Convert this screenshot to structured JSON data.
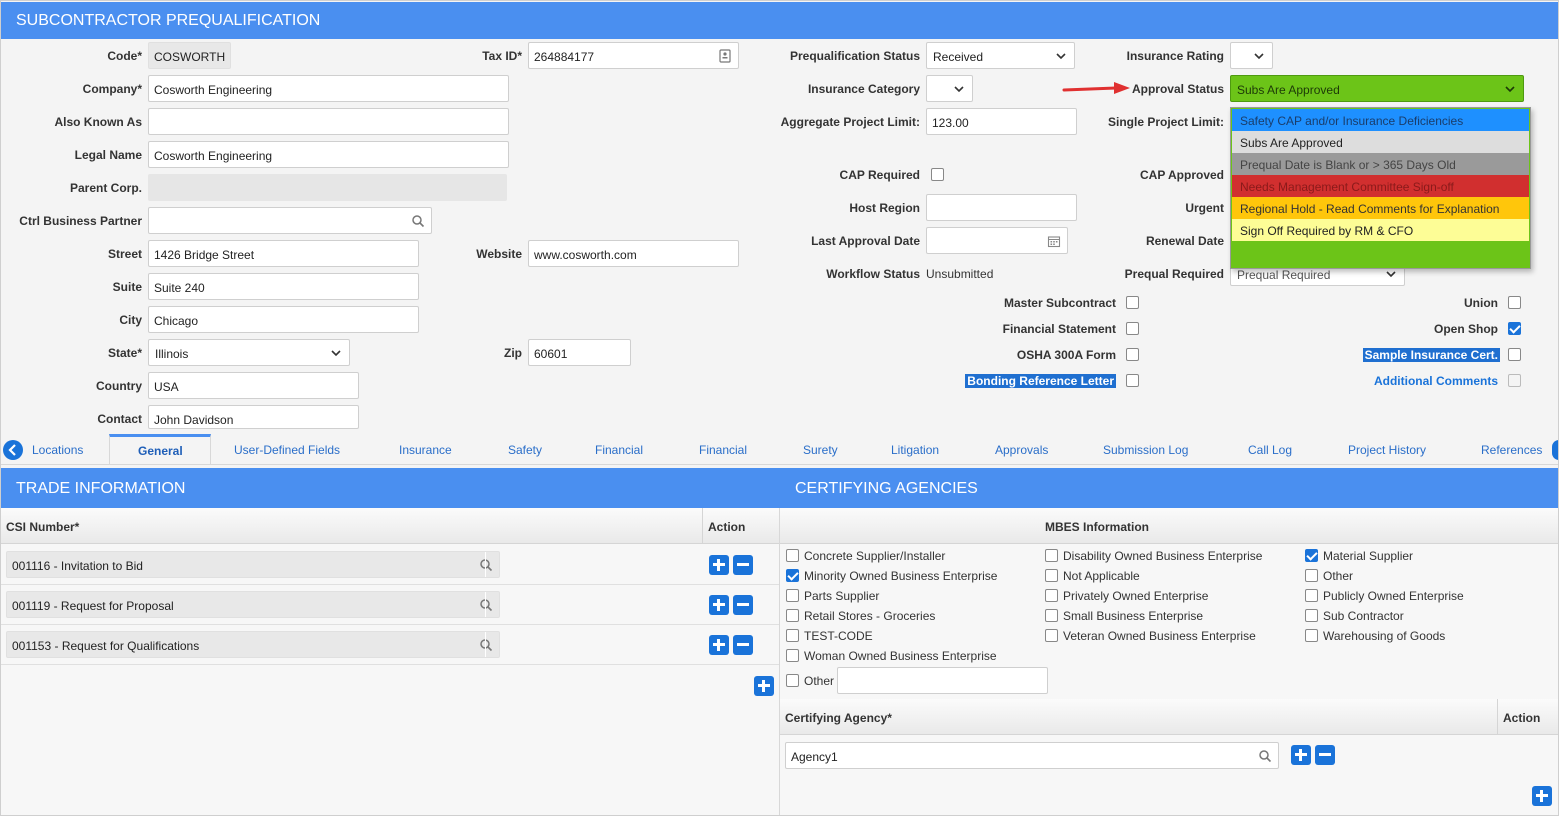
{
  "header": {
    "title": "SUBCONTRACTOR PREQUALIFICATION"
  },
  "left_fields": {
    "code_label": "Code*",
    "code_value": "COSWORTH",
    "tax_label": "Tax ID*",
    "tax_value": "264884177",
    "company_label": "Company*",
    "company_value": "Cosworth Engineering",
    "aka_label": "Also Known As",
    "aka_value": "",
    "legal_label": "Legal Name",
    "legal_value": "Cosworth Engineering",
    "parent_label": "Parent Corp.",
    "ctrl_label": "Ctrl Business Partner",
    "street_label": "Street",
    "street_value": "1426 Bridge Street",
    "website_label": "Website",
    "website_value": "www.cosworth.com",
    "suite_label": "Suite",
    "suite_value": "Suite 240",
    "city_label": "City",
    "city_value": "Chicago",
    "state_label": "State*",
    "state_value": "Illinois",
    "zip_label": "Zip",
    "zip_value": "60601",
    "country_label": "Country",
    "country_value": "USA",
    "contact_label": "Contact",
    "contact_value": "John Davidson"
  },
  "right_fields": {
    "preq_status_label": "Prequalification Status",
    "preq_status_value": "Received",
    "ins_rating_label": "Insurance Rating",
    "ins_cat_label": "Insurance Category",
    "approval_label": "Approval Status",
    "approval_value": "Subs Are Approved",
    "agg_label": "Aggregate Project Limit:",
    "agg_value": "123.00",
    "single_label": "Single Project Limit:",
    "cap_req_label": "CAP Required",
    "cap_appr_label": "CAP Approved",
    "host_label": "Host Region",
    "urgent_label": "Urgent",
    "last_appr_label": "Last Approval Date",
    "renewal_label": "Renewal Date",
    "workflow_label": "Workflow Status",
    "workflow_value": "Unsubmitted",
    "preq_req_label": "Prequal Required",
    "preq_req_value": "Prequal Required",
    "master_label": "Master Subcontract",
    "fin_stmt_label": "Financial Statement",
    "osha_label": "OSHA 300A Form",
    "bonding_label": "Bonding Reference Letter",
    "union_label": "Union",
    "open_shop_label": "Open Shop",
    "sample_ins_label": "Sample Insurance Cert.",
    "add_comments_label": "Additional Comments"
  },
  "approval_options": [
    {
      "label": "Safety CAP and/or Insurance Deficiencies",
      "bg": "#1e90ff",
      "fg": "#1a3d6b"
    },
    {
      "label": "Subs Are Approved",
      "bg": "#dddddd",
      "fg": "#222222"
    },
    {
      "label": "Prequal Date is Blank or > 365 Days Old",
      "bg": "#9a9a9a",
      "fg": "#444444"
    },
    {
      "label": "Needs Management Committee Sign-off",
      "bg": "#d12f2f",
      "fg": "#8a1a1a"
    },
    {
      "label": "Regional Hold - Read Comments for Explanation",
      "bg": "#ffc60b",
      "fg": "#333333"
    },
    {
      "label": "Sign Off Required by RM & CFO",
      "bg": "#fdfd96",
      "fg": "#222222"
    }
  ],
  "colors": {
    "accent": "#4a8ff0",
    "approved_green": "#6cc418",
    "link_blue": "#1a73d9"
  },
  "tabs": [
    "Locations",
    "General",
    "User-Defined Fields",
    "Insurance",
    "Safety",
    "Financial",
    "Financial",
    "Surety",
    "Litigation",
    "Approvals",
    "Submission Log",
    "Call Log",
    "Project History",
    "References"
  ],
  "trade": {
    "title": "TRADE INFORMATION",
    "col_csi": "CSI Number*",
    "col_action": "Action",
    "rows": [
      "001116 - Invitation to Bid",
      "001119 - Request for Proposal",
      "001153 - Request for Qualifications"
    ]
  },
  "cert": {
    "title": "CERTIFYING AGENCIES",
    "mbes_header": "MBES Information",
    "col1": [
      {
        "label": "Concrete Supplier/Installer",
        "checked": false
      },
      {
        "label": "Minority Owned Business Enterprise",
        "checked": true
      },
      {
        "label": "Parts Supplier",
        "checked": false
      },
      {
        "label": "Retail Stores - Groceries",
        "checked": false
      },
      {
        "label": "TEST-CODE",
        "checked": false
      },
      {
        "label": "Woman Owned Business Enterprise",
        "checked": false
      }
    ],
    "col2": [
      {
        "label": "Disability Owned Business Enterprise",
        "checked": false
      },
      {
        "label": "Not Applicable",
        "checked": false
      },
      {
        "label": "Privately Owned Enterprise",
        "checked": false
      },
      {
        "label": "Small Business Enterprise",
        "checked": false
      },
      {
        "label": "Veteran Owned Business Enterprise",
        "checked": false
      }
    ],
    "col3": [
      {
        "label": "Material Supplier",
        "checked": true
      },
      {
        "label": "Other",
        "checked": false
      },
      {
        "label": "Publicly Owned Enterprise",
        "checked": false
      },
      {
        "label": "Sub Contractor",
        "checked": false
      },
      {
        "label": "Warehousing of Goods",
        "checked": false
      }
    ],
    "other_label": "Other",
    "col_agency": "Certifying Agency*",
    "col_action": "Action",
    "agency_value": "Agency1"
  }
}
